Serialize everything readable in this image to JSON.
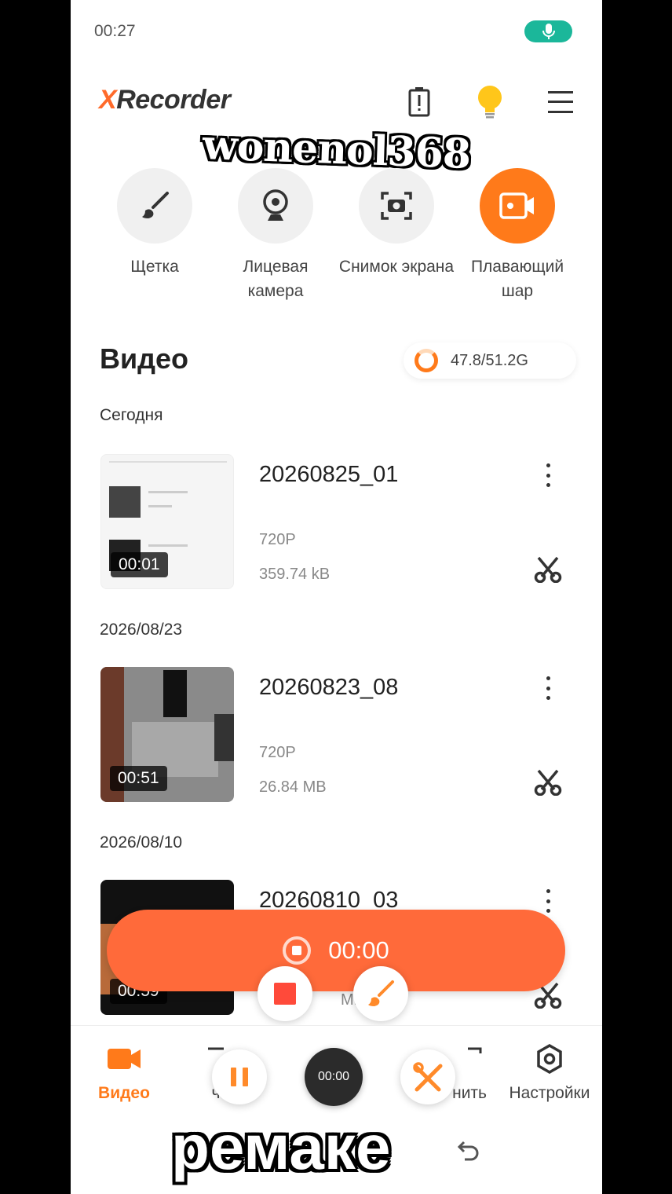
{
  "status_bar": {
    "time": "00:27"
  },
  "header": {
    "logo_x": "X",
    "logo_rest": "Recorder"
  },
  "overlay": {
    "top_watermark": "wonenol368",
    "bottom_caption": "ремаке"
  },
  "tools": [
    {
      "label": "Щетка",
      "icon": "brush-icon"
    },
    {
      "label": "Лицевая камера",
      "icon": "webcam-icon"
    },
    {
      "label": "Снимок экрана",
      "icon": "screenshot-icon"
    },
    {
      "label": "Плавающий шар",
      "icon": "floating-ball-icon"
    }
  ],
  "section": {
    "title": "Видео",
    "storage": "47.8/51.2G"
  },
  "groups": [
    {
      "date": "Сегодня",
      "video": {
        "name": "20260825_01",
        "resolution": "720P",
        "size": "359.74 kB",
        "duration": "00:01"
      }
    },
    {
      "date": "2026/08/23",
      "video": {
        "name": "20260823_08",
        "resolution": "720P",
        "size": "26.84 MB",
        "duration": "00:51"
      }
    },
    {
      "date": "2026/08/10",
      "video": {
        "name": "20260810_03",
        "resolution": "",
        "size": "MB",
        "duration": "00:59"
      }
    }
  ],
  "recording_bar": {
    "time": "00:00"
  },
  "floating_timer": "00:00",
  "bottom_nav": [
    {
      "label": "Видео",
      "icon": "video-icon",
      "active": true
    },
    {
      "label": "ч",
      "icon": "image-icon",
      "active": false
    },
    {
      "label": "нить",
      "icon": "tools-icon",
      "active": false
    },
    {
      "label": "Настройки",
      "icon": "settings-icon",
      "active": false
    }
  ],
  "colors": {
    "accent": "#ff7a1a",
    "record_bar": "#ff6a3a",
    "mic_pill": "#1bb79a"
  }
}
